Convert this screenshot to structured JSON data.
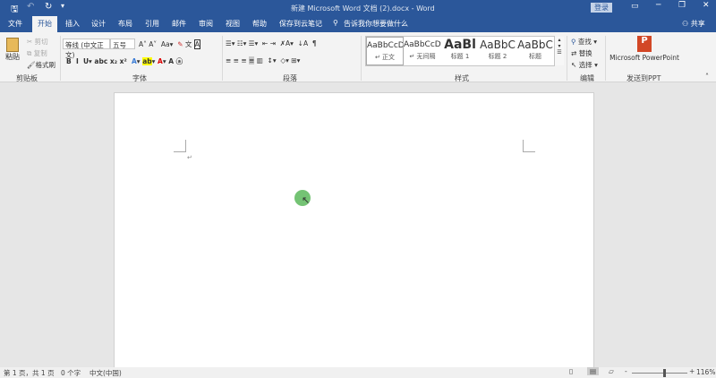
{
  "title": "新建 Microsoft Word 文档 (2).docx  -  Word",
  "login": "登录",
  "tabs": [
    "文件",
    "开始",
    "插入",
    "设计",
    "布局",
    "引用",
    "邮件",
    "审阅",
    "视图",
    "帮助",
    "保存到云笔记"
  ],
  "tell_me": "告诉我你想要做什么",
  "share": "共享",
  "clipboard": {
    "paste": "粘贴",
    "cut": "剪切",
    "copy": "复制",
    "format_painter": "格式刷",
    "label": "剪贴板"
  },
  "font": {
    "name": "等线 (中文正文)",
    "size": "五号",
    "label": "字体"
  },
  "paragraph": {
    "label": "段落"
  },
  "styles": {
    "items": [
      {
        "preview": "AaBbCcDc",
        "name": "↵ 正文"
      },
      {
        "preview": "AaBbCcDc",
        "name": "↵ 无间隔"
      },
      {
        "preview": "AaBl",
        "name": "标题 1"
      },
      {
        "preview": "AaBbC",
        "name": "标题 2"
      },
      {
        "preview": "AaBbC",
        "name": "标题"
      }
    ],
    "label": "样式"
  },
  "editing": {
    "find": "查找",
    "replace": "替换",
    "select": "选择",
    "label": "编辑"
  },
  "ppt": {
    "button": "Microsoft PowerPoint",
    "label": "发送到PPT"
  },
  "status": {
    "page": "第 1 页，共 1 页",
    "words": "0 个字",
    "lang": "中文(中国)",
    "zoom": "116%"
  },
  "zoom_fraction": 0.58
}
